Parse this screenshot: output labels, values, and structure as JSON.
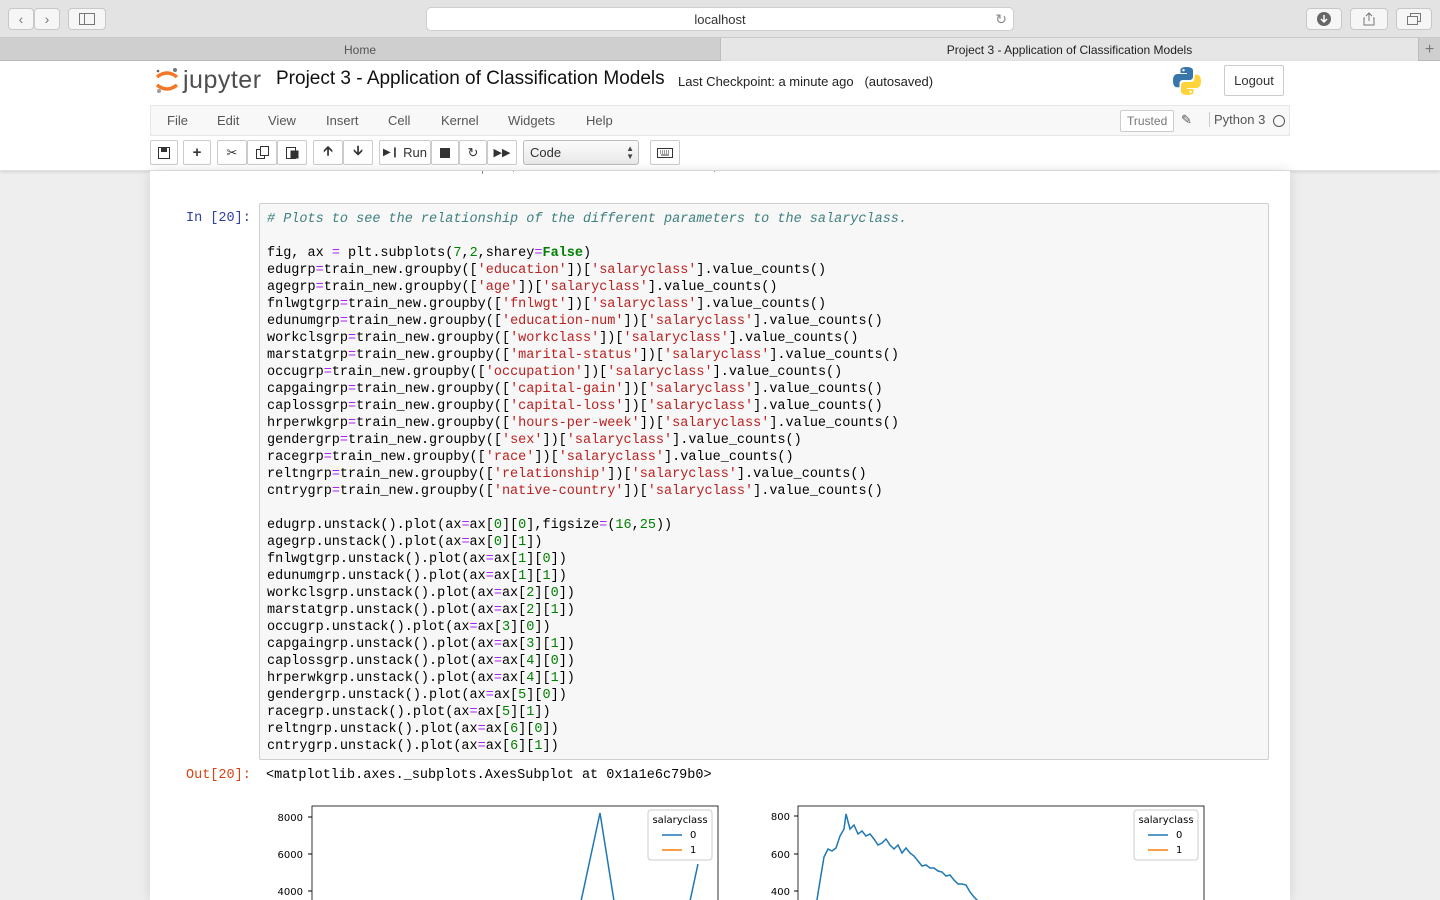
{
  "browser": {
    "address": "localhost",
    "tabs": [
      "Home",
      "Project 3 - Application of Classification Models"
    ]
  },
  "jupyter": {
    "logo_text": "jupyter",
    "notebook_title": "Project 3 - Application of Classification Models",
    "checkpoint": "Last Checkpoint: a minute ago",
    "autosaved": "(autosaved)",
    "logout_label": "Logout",
    "menu": [
      "File",
      "Edit",
      "View",
      "Insert",
      "Cell",
      "Kernel",
      "Widgets",
      "Help"
    ],
    "trusted": "Trusted",
    "kernel": "Python 3",
    "toolbar": {
      "run_label": "Run",
      "cell_type": "Code"
    }
  },
  "cell": {
    "in_prompt": "In [20]:",
    "out_prompt": "Out[20]:",
    "output_text": "<matplotlib.axes._subplots.AxesSubplot at 0x1a1e6c79b0>"
  },
  "chart_data": [
    {
      "type": "line",
      "legend_title": "salaryclass",
      "series": [
        {
          "name": "0",
          "color": "#1f77b4"
        },
        {
          "name": "1",
          "color": "#ff7f0e"
        }
      ],
      "yticks": [
        4000,
        6000,
        8000
      ],
      "legend": "top-right"
    },
    {
      "type": "line",
      "legend_title": "salaryclass",
      "series": [
        {
          "name": "0",
          "color": "#1f77b4"
        },
        {
          "name": "1",
          "color": "#ff7f0e"
        }
      ],
      "yticks": [
        400,
        600,
        800
      ],
      "legend": "top-right"
    }
  ]
}
